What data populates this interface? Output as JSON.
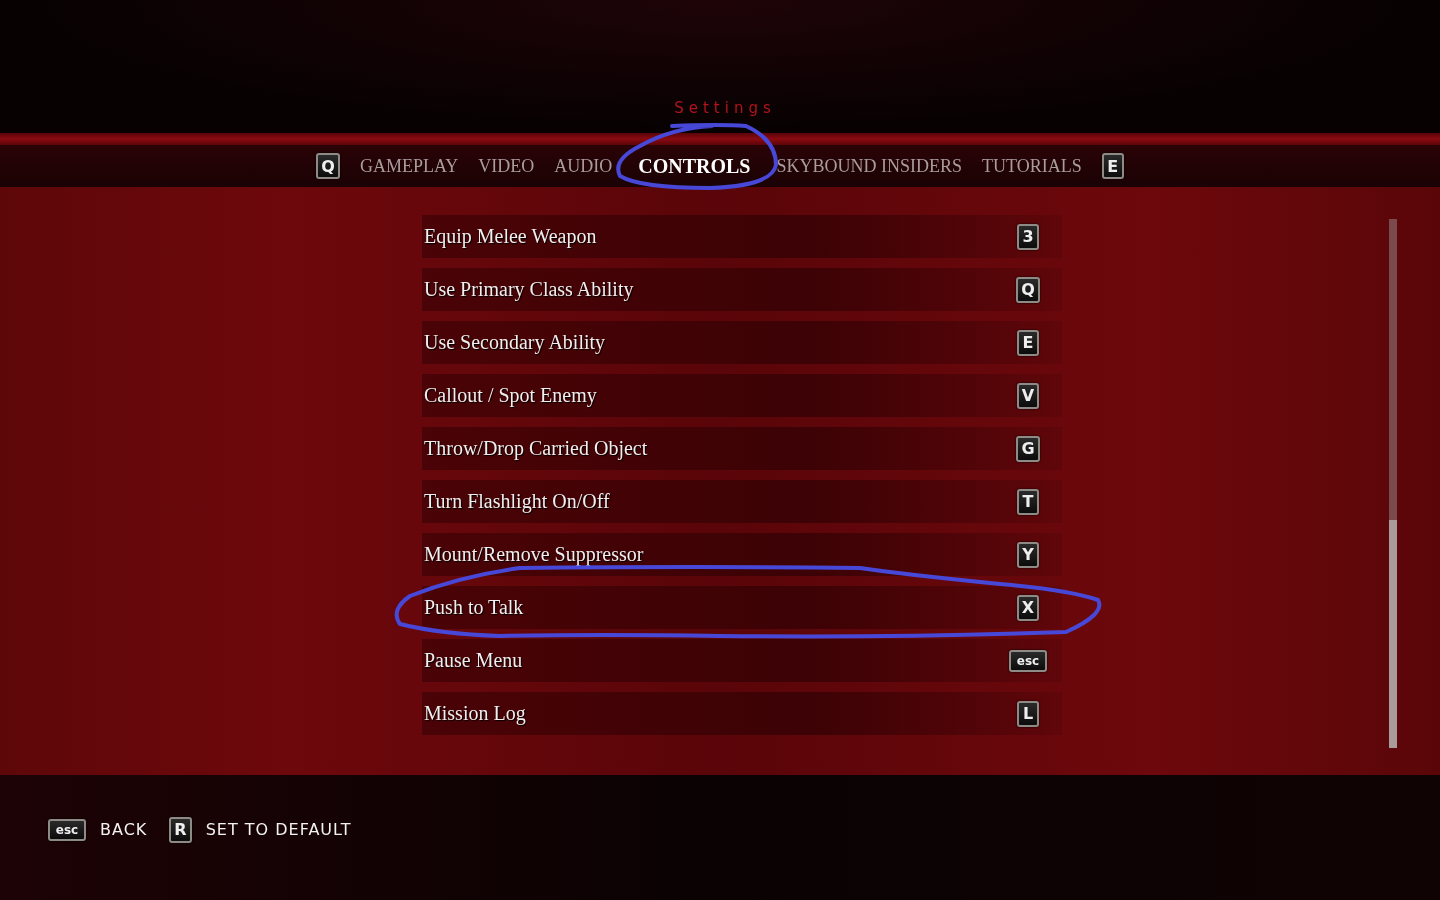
{
  "title": "Settings",
  "tab_bar": {
    "prev_key": "Q",
    "next_key": "E",
    "tabs": [
      {
        "label": "GAMEPLAY",
        "selected": false
      },
      {
        "label": "VIDEO",
        "selected": false
      },
      {
        "label": "AUDIO",
        "selected": false
      },
      {
        "label": "CONTROLS",
        "selected": true
      },
      {
        "label": "SKYBOUND INSIDERS",
        "selected": false
      },
      {
        "label": "TUTORIALS",
        "selected": false
      }
    ]
  },
  "bindings": [
    {
      "action": "Equip Melee Weapon",
      "key": "3"
    },
    {
      "action": "Use Primary Class Ability",
      "key": "Q"
    },
    {
      "action": "Use Secondary Ability",
      "key": "E"
    },
    {
      "action": "Callout / Spot Enemy",
      "key": "V"
    },
    {
      "action": "Throw/Drop Carried Object",
      "key": "G"
    },
    {
      "action": "Turn Flashlight On/Off",
      "key": "T"
    },
    {
      "action": "Mount/Remove Suppressor",
      "key": "Y"
    },
    {
      "action": "Push to Talk",
      "key": "X"
    },
    {
      "action": "Pause Menu",
      "key": "esc"
    },
    {
      "action": "Mission Log",
      "key": "L"
    }
  ],
  "footer": [
    {
      "key": "esc",
      "label": "BACK"
    },
    {
      "key": "R",
      "label": "SET TO DEFAULT"
    }
  ]
}
